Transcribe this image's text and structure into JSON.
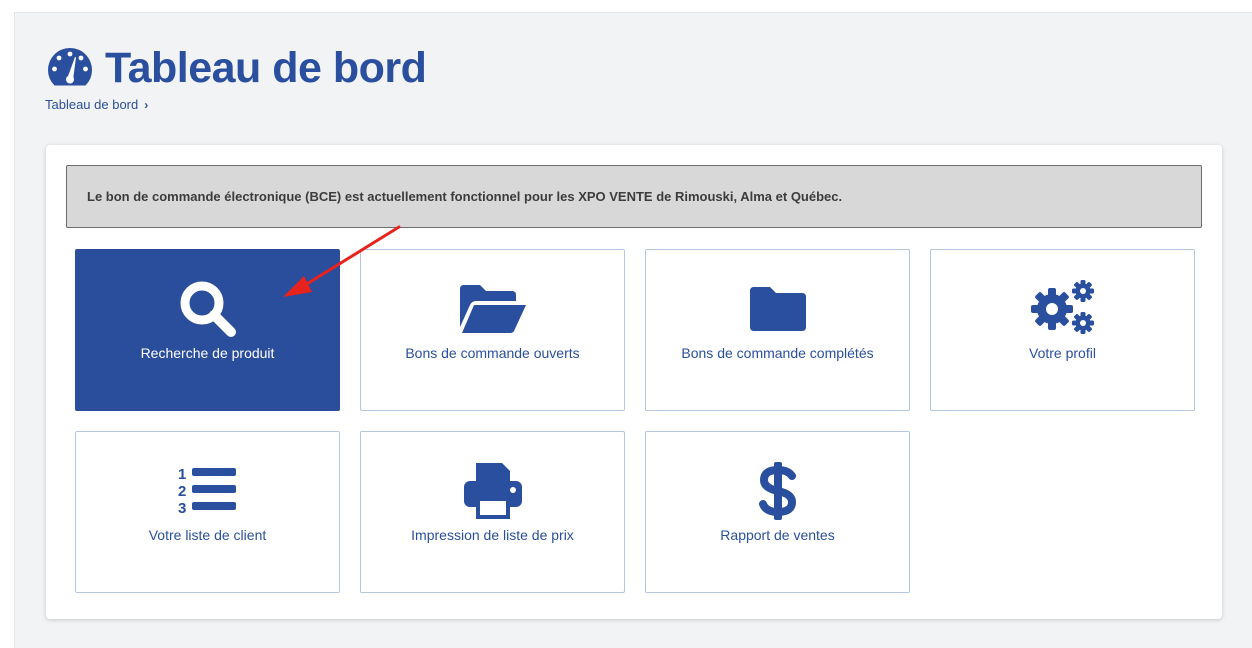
{
  "header": {
    "title": "Tableau de bord",
    "breadcrumb": {
      "item": "Tableau de bord",
      "separator": "›"
    }
  },
  "notice": {
    "text": "Le bon de commande électronique (BCE) est actuellement fonctionnel pour les XPO VENTE de Rimouski, Alma et Québec."
  },
  "tiles": [
    {
      "label": "Recherche de produit",
      "icon": "search-icon",
      "active": true
    },
    {
      "label": "Bons de commande ouverts",
      "icon": "folder-open-icon",
      "active": false
    },
    {
      "label": "Bons de commande complétés",
      "icon": "folder-icon",
      "active": false
    },
    {
      "label": "Votre profil",
      "icon": "gears-icon",
      "active": false
    },
    {
      "label": "Votre liste de client",
      "icon": "numbered-list-icon",
      "active": false
    },
    {
      "label": "Impression de liste de prix",
      "icon": "printer-icon",
      "active": false
    },
    {
      "label": "Rapport de ventes",
      "icon": "dollar-icon",
      "active": false
    }
  ],
  "colors": {
    "brand_blue": "#2a4f9e",
    "active_tile": "#2a4d9c",
    "notice_bg": "#d8d8d8",
    "annotation_arrow": "#e8231e"
  }
}
